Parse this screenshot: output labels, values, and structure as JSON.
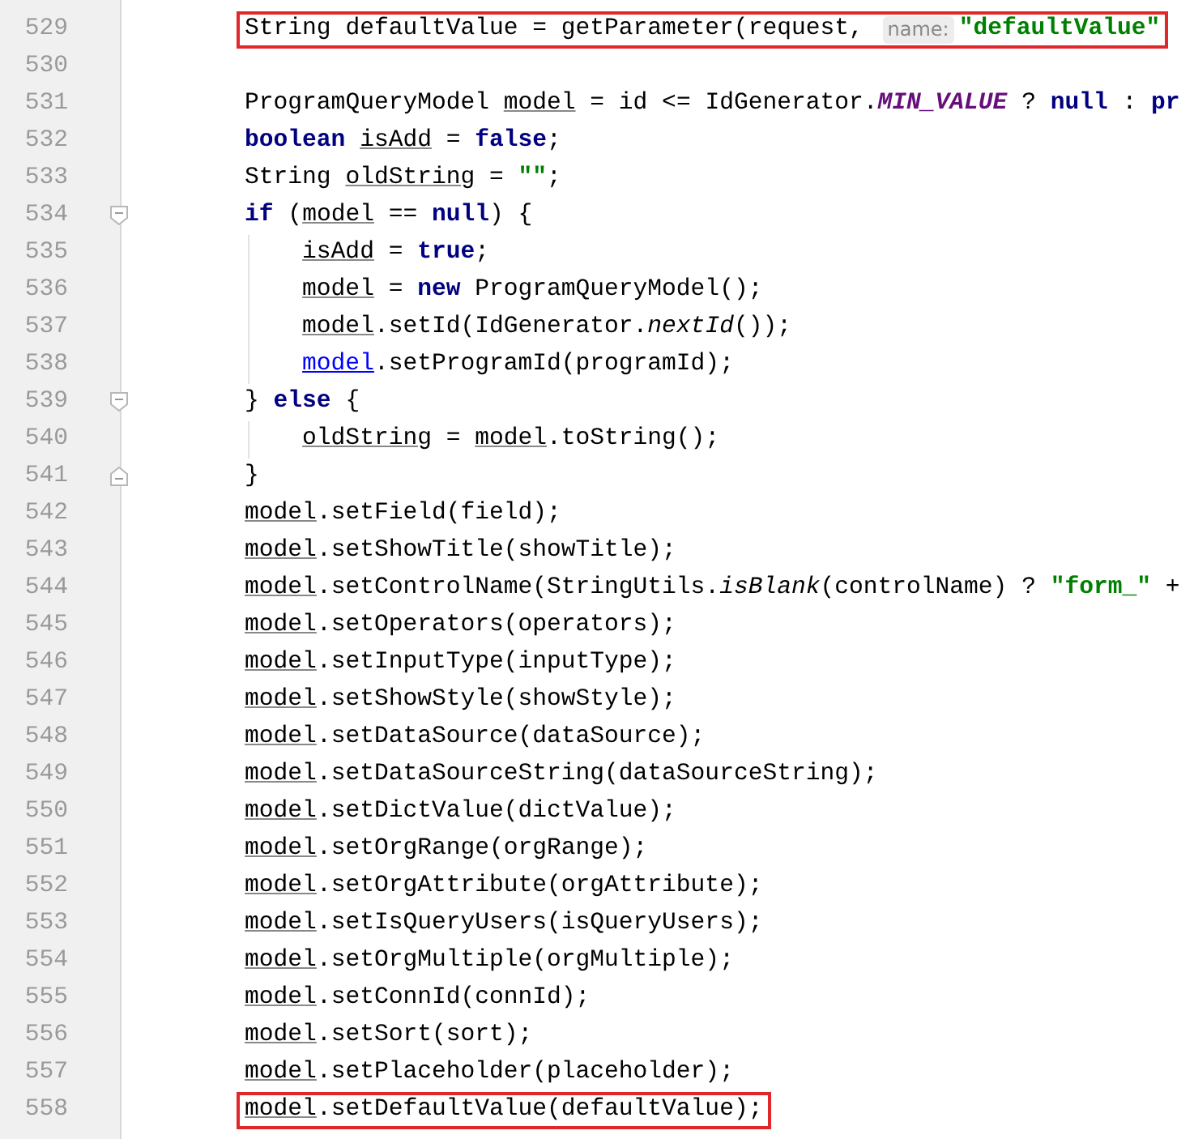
{
  "editor": {
    "lines": [
      {
        "number": "529",
        "boxed": true,
        "tokens": [
          {
            "kind": "plain",
            "text": "String defaultValue = getParameter(request, "
          },
          {
            "kind": "hint",
            "text": "name:"
          },
          {
            "kind": "string",
            "text": "\"defaultValue\""
          }
        ]
      },
      {
        "number": "530"
      },
      {
        "number": "531",
        "tokens": [
          {
            "kind": "plain",
            "text": "ProgramQueryModel "
          },
          {
            "kind": "var",
            "text": "model"
          },
          {
            "kind": "plain",
            "text": " = id <= IdGenerator."
          },
          {
            "kind": "static",
            "text": "MIN_VALUE"
          },
          {
            "kind": "plain",
            "text": " ? "
          },
          {
            "kind": "keyword",
            "text": "null"
          },
          {
            "kind": "plain",
            "text": " : "
          },
          {
            "kind": "keyword",
            "text": "pr"
          }
        ]
      },
      {
        "number": "532",
        "tokens": [
          {
            "kind": "keyword",
            "text": "boolean "
          },
          {
            "kind": "var",
            "text": "isAdd"
          },
          {
            "kind": "plain",
            "text": " = "
          },
          {
            "kind": "keyword",
            "text": "false"
          },
          {
            "kind": "plain",
            "text": ";"
          }
        ]
      },
      {
        "number": "533",
        "tokens": [
          {
            "kind": "plain",
            "text": "String "
          },
          {
            "kind": "var",
            "text": "oldString"
          },
          {
            "kind": "plain",
            "text": " = "
          },
          {
            "kind": "string",
            "text": "\"\""
          },
          {
            "kind": "plain",
            "text": ";"
          }
        ]
      },
      {
        "number": "534",
        "fold_start": true,
        "tokens": [
          {
            "kind": "keyword",
            "text": "if"
          },
          {
            "kind": "plain",
            "text": " ("
          },
          {
            "kind": "var",
            "text": "model"
          },
          {
            "kind": "plain",
            "text": " == "
          },
          {
            "kind": "keyword",
            "text": "null"
          },
          {
            "kind": "plain",
            "text": ") {"
          }
        ]
      },
      {
        "number": "535",
        "nested": true,
        "tokens": [
          {
            "kind": "var",
            "text": "isAdd"
          },
          {
            "kind": "plain",
            "text": " = "
          },
          {
            "kind": "keyword",
            "text": "true"
          },
          {
            "kind": "plain",
            "text": ";"
          }
        ]
      },
      {
        "number": "536",
        "nested": true,
        "tokens": [
          {
            "kind": "var",
            "text": "model"
          },
          {
            "kind": "plain",
            "text": " = "
          },
          {
            "kind": "keyword",
            "text": "new"
          },
          {
            "kind": "plain",
            "text": " ProgramQueryModel();"
          }
        ]
      },
      {
        "number": "537",
        "nested": true,
        "tokens": [
          {
            "kind": "var",
            "text": "model"
          },
          {
            "kind": "plain",
            "text": ".setId(IdGenerator."
          },
          {
            "kind": "italic",
            "text": "nextId"
          },
          {
            "kind": "plain",
            "text": "());"
          }
        ]
      },
      {
        "number": "538",
        "nested": true,
        "tokens": [
          {
            "kind": "link",
            "text": "model"
          },
          {
            "kind": "plain",
            "text": ".setProgramId(programId);"
          }
        ]
      },
      {
        "number": "539",
        "fold_start": true,
        "tokens": [
          {
            "kind": "plain",
            "text": "} "
          },
          {
            "kind": "keyword",
            "text": "else"
          },
          {
            "kind": "plain",
            "text": " {"
          }
        ]
      },
      {
        "number": "540",
        "nested": true,
        "tokens": [
          {
            "kind": "var",
            "text": "oldString"
          },
          {
            "kind": "plain",
            "text": " = "
          },
          {
            "kind": "var",
            "text": "model"
          },
          {
            "kind": "plain",
            "text": ".toString();"
          }
        ]
      },
      {
        "number": "541",
        "fold_end": true,
        "tokens": [
          {
            "kind": "plain",
            "text": "}"
          }
        ]
      },
      {
        "number": "542",
        "tokens": [
          {
            "kind": "var",
            "text": "model"
          },
          {
            "kind": "plain",
            "text": ".setField(field);"
          }
        ]
      },
      {
        "number": "543",
        "tokens": [
          {
            "kind": "var",
            "text": "model"
          },
          {
            "kind": "plain",
            "text": ".setShowTitle(showTitle);"
          }
        ]
      },
      {
        "number": "544",
        "tokens": [
          {
            "kind": "var",
            "text": "model"
          },
          {
            "kind": "plain",
            "text": ".setControlName(StringUtils."
          },
          {
            "kind": "italic",
            "text": "isBlank"
          },
          {
            "kind": "plain",
            "text": "(controlName) ? "
          },
          {
            "kind": "string",
            "text": "\"form_\""
          },
          {
            "kind": "plain",
            "text": " +"
          }
        ]
      },
      {
        "number": "545",
        "tokens": [
          {
            "kind": "var",
            "text": "model"
          },
          {
            "kind": "plain",
            "text": ".setOperators(operators);"
          }
        ]
      },
      {
        "number": "546",
        "tokens": [
          {
            "kind": "var",
            "text": "model"
          },
          {
            "kind": "plain",
            "text": ".setInputType(inputType);"
          }
        ]
      },
      {
        "number": "547",
        "tokens": [
          {
            "kind": "var",
            "text": "model"
          },
          {
            "kind": "plain",
            "text": ".setShowStyle(showStyle);"
          }
        ]
      },
      {
        "number": "548",
        "tokens": [
          {
            "kind": "var",
            "text": "model"
          },
          {
            "kind": "plain",
            "text": ".setDataSource(dataSource);"
          }
        ]
      },
      {
        "number": "549",
        "tokens": [
          {
            "kind": "var",
            "text": "model"
          },
          {
            "kind": "plain",
            "text": ".setDataSourceString(dataSourceString);"
          }
        ]
      },
      {
        "number": "550",
        "tokens": [
          {
            "kind": "var",
            "text": "model"
          },
          {
            "kind": "plain",
            "text": ".setDictValue(dictValue);"
          }
        ]
      },
      {
        "number": "551",
        "tokens": [
          {
            "kind": "var",
            "text": "model"
          },
          {
            "kind": "plain",
            "text": ".setOrgRange(orgRange);"
          }
        ]
      },
      {
        "number": "552",
        "tokens": [
          {
            "kind": "var",
            "text": "model"
          },
          {
            "kind": "plain",
            "text": ".setOrgAttribute(orgAttribute);"
          }
        ]
      },
      {
        "number": "553",
        "tokens": [
          {
            "kind": "var",
            "text": "model"
          },
          {
            "kind": "plain",
            "text": ".setIsQueryUsers(isQueryUsers);"
          }
        ]
      },
      {
        "number": "554",
        "tokens": [
          {
            "kind": "var",
            "text": "model"
          },
          {
            "kind": "plain",
            "text": ".setOrgMultiple(orgMultiple);"
          }
        ]
      },
      {
        "number": "555",
        "tokens": [
          {
            "kind": "var",
            "text": "model"
          },
          {
            "kind": "plain",
            "text": ".setConnId(connId);"
          }
        ]
      },
      {
        "number": "556",
        "tokens": [
          {
            "kind": "var",
            "text": "model"
          },
          {
            "kind": "plain",
            "text": ".setSort(sort);"
          }
        ]
      },
      {
        "number": "557",
        "tokens": [
          {
            "kind": "var",
            "text": "model"
          },
          {
            "kind": "plain",
            "text": ".setPlaceholder(placeholder);"
          }
        ]
      },
      {
        "number": "558",
        "boxed": true,
        "tokens": [
          {
            "kind": "var",
            "text": "model"
          },
          {
            "kind": "plain",
            "text": ".setDefaultValue(defaultValue);"
          }
        ]
      }
    ]
  }
}
